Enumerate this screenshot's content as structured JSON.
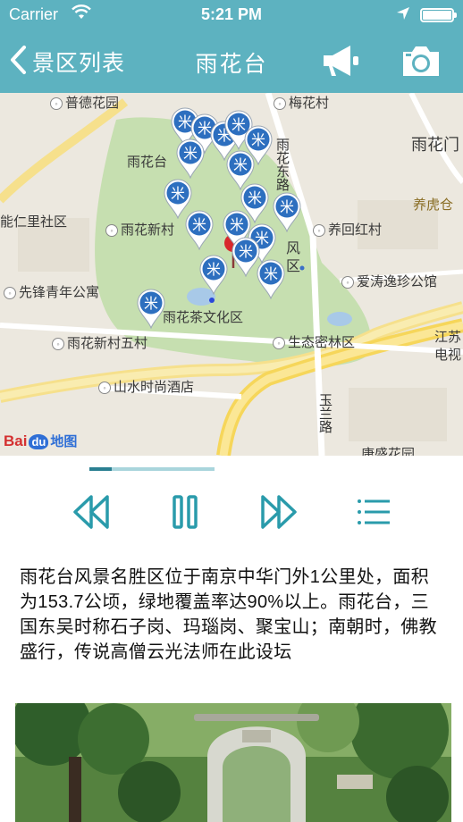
{
  "status_bar": {
    "carrier": "Carrier",
    "time": "5:21 PM"
  },
  "nav": {
    "back_label": "景区列表",
    "title": "雨花台"
  },
  "map": {
    "labels": [
      "普德花园",
      "梅花村",
      "雨花门",
      "雨花台",
      "养虎仓",
      "能仁里社区",
      "雨花新村",
      "养回红村",
      "风",
      "区",
      "爱涛逸珍公馆",
      "先锋青年公寓",
      "雨花茶文化区",
      "雨花新村五村",
      "生态密林区",
      "江苏",
      "电视",
      "山水时尚酒店",
      "康盛花园"
    ],
    "roads": [
      "雨花东路",
      "玉兰路"
    ],
    "marker_glyph": "米",
    "attribution": {
      "bai": "Bai",
      "du": "du",
      "tu": "地图"
    }
  },
  "player": {
    "progress": 0.18
  },
  "description": "雨花台风景名胜区位于南京中华门外1公里处，面积为153.7公顷，绿地覆盖率达90%以上。雨花台，三国东吴时称石子岗、玛瑙岗、聚宝山；南朝时，佛教盛行，传说高僧云光法师在此设坛",
  "colors": {
    "header": "#5db2c0",
    "accent": "#2a9bab",
    "marker": "#2d6fbf",
    "park": "#c6dfb0"
  }
}
